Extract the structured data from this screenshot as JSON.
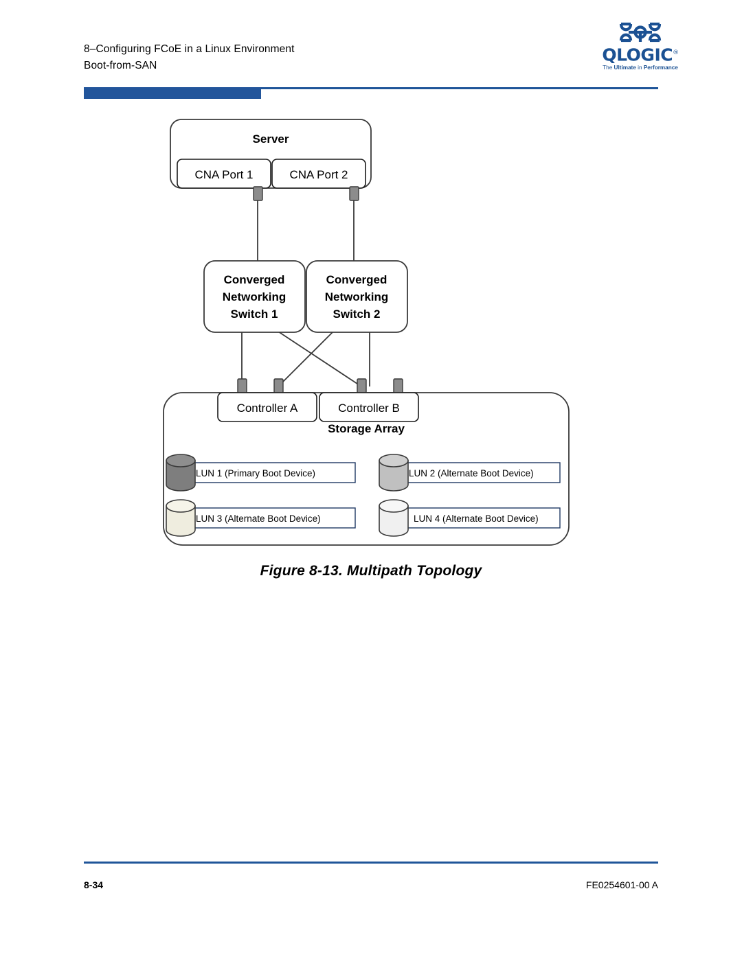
{
  "header": {
    "chapter_line": "8–Configuring FCoE in a Linux Environment",
    "section_line": "Boot-from-SAN",
    "logo": {
      "wordmark": "QLOGIC",
      "registered": "®",
      "tagline_pre": "The ",
      "tagline_bold": "Ultimate",
      "tagline_mid": " in ",
      "tagline_bold2": "Performance"
    },
    "accent_color": "#22559B"
  },
  "figure": {
    "caption": "Figure 8-13. Multipath Topology",
    "server": {
      "title": "Server",
      "ports": [
        {
          "label": "CNA Port 1"
        },
        {
          "label": "CNA Port 2"
        }
      ]
    },
    "switches": [
      {
        "line1": "Converged",
        "line2": "Networking",
        "line3": "Switch 1"
      },
      {
        "line1": "Converged",
        "line2": "Networking",
        "line3": "Switch 2"
      }
    ],
    "controllers": [
      {
        "label": "Controller A"
      },
      {
        "label": "Controller B"
      }
    ],
    "storage_array": {
      "title": "Storage Array",
      "luns": [
        {
          "label": "LUN 1 (Primary Boot Device)",
          "color": "#7E7E7E",
          "top_color": "#8E8E8E"
        },
        {
          "label": "LUN 2 (Alternate Boot Device)",
          "color": "#C0C0C0",
          "top_color": "#CFCFCF"
        },
        {
          "label": "LUN 3 (Alternate Boot Device)",
          "color": "#EFEDDF",
          "top_color": "#F6F4E9"
        },
        {
          "label": "LUN 4 (Alternate Boot Device)",
          "color": "#F0F0F0",
          "top_color": "#F7F7F7"
        }
      ]
    },
    "connector_color": "#8C8C8C"
  },
  "footer": {
    "page_number": "8-34",
    "document_number": "FE0254601-00 A"
  }
}
